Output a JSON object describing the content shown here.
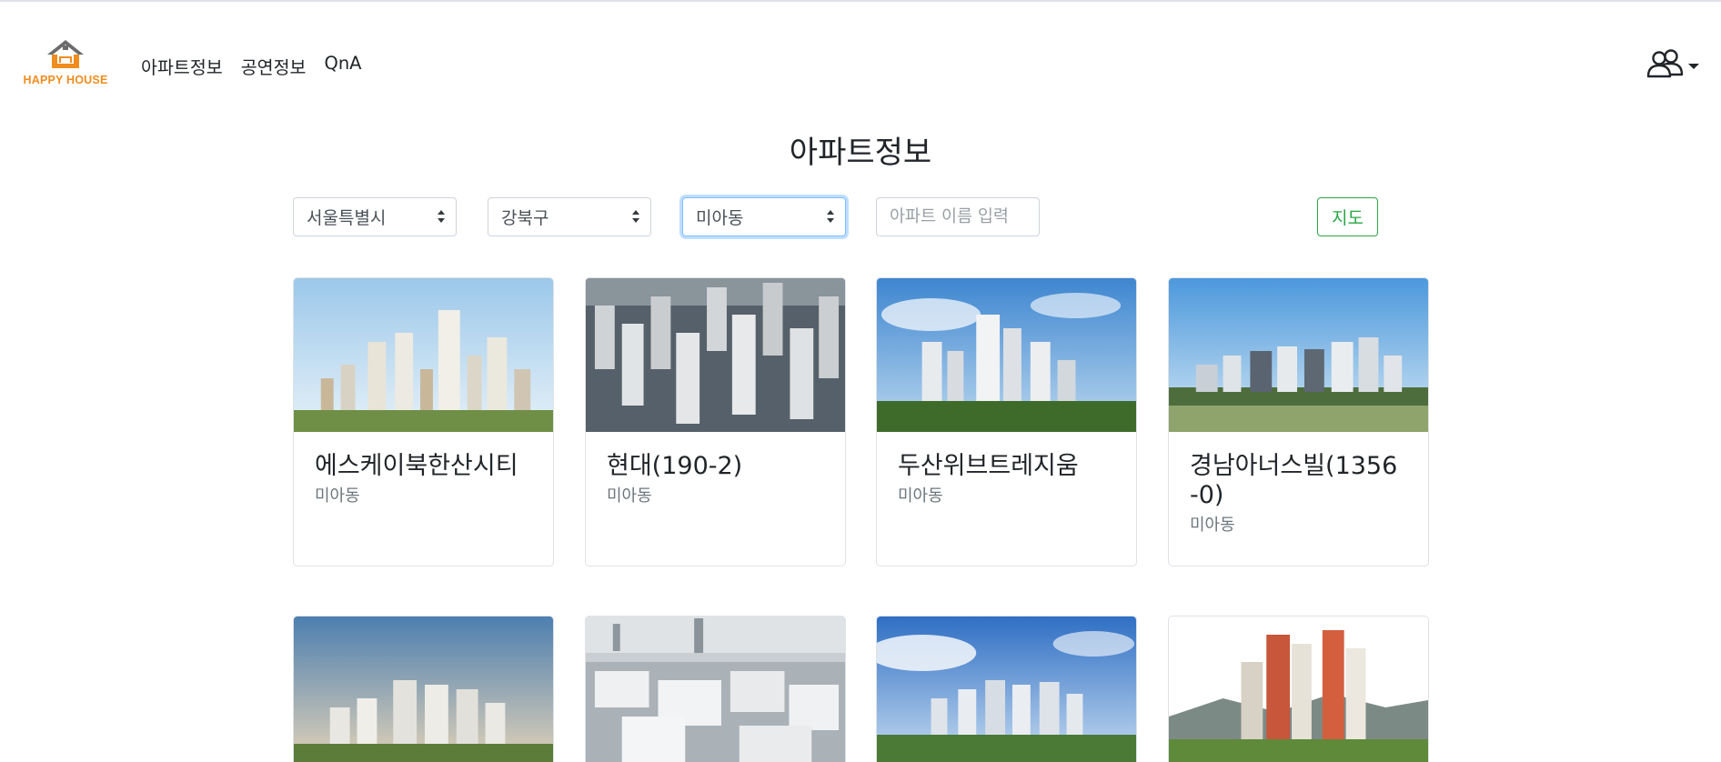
{
  "brand": {
    "name": "HAPPY HOUSE",
    "color": "#f08c1e"
  },
  "nav": {
    "items": [
      "아파트정보",
      "공연정보",
      "QnA"
    ]
  },
  "page": {
    "title": "아파트정보"
  },
  "filters": {
    "city": "서울특별시",
    "gu": "강북구",
    "dong": "미아동",
    "apt_name_placeholder": "아파트 이름 입력",
    "map_button": "지도"
  },
  "colors": {
    "accent_green": "#28a745",
    "focus_blue": "#80bdff"
  },
  "apartments": [
    {
      "name": "에스케이북한산시티",
      "dong": "미아동"
    },
    {
      "name": "현대(190-2)",
      "dong": "미아동"
    },
    {
      "name": "두산위브트레지움",
      "dong": "미아동"
    },
    {
      "name": "경남아너스빌(1356-0)",
      "dong": "미아동"
    },
    {
      "name": "",
      "dong": ""
    },
    {
      "name": "",
      "dong": ""
    },
    {
      "name": "",
      "dong": ""
    },
    {
      "name": "",
      "dong": ""
    }
  ],
  "icons": {
    "logo": "house-logo-icon",
    "user": "users-icon",
    "dropdown": "caret-down-icon"
  }
}
